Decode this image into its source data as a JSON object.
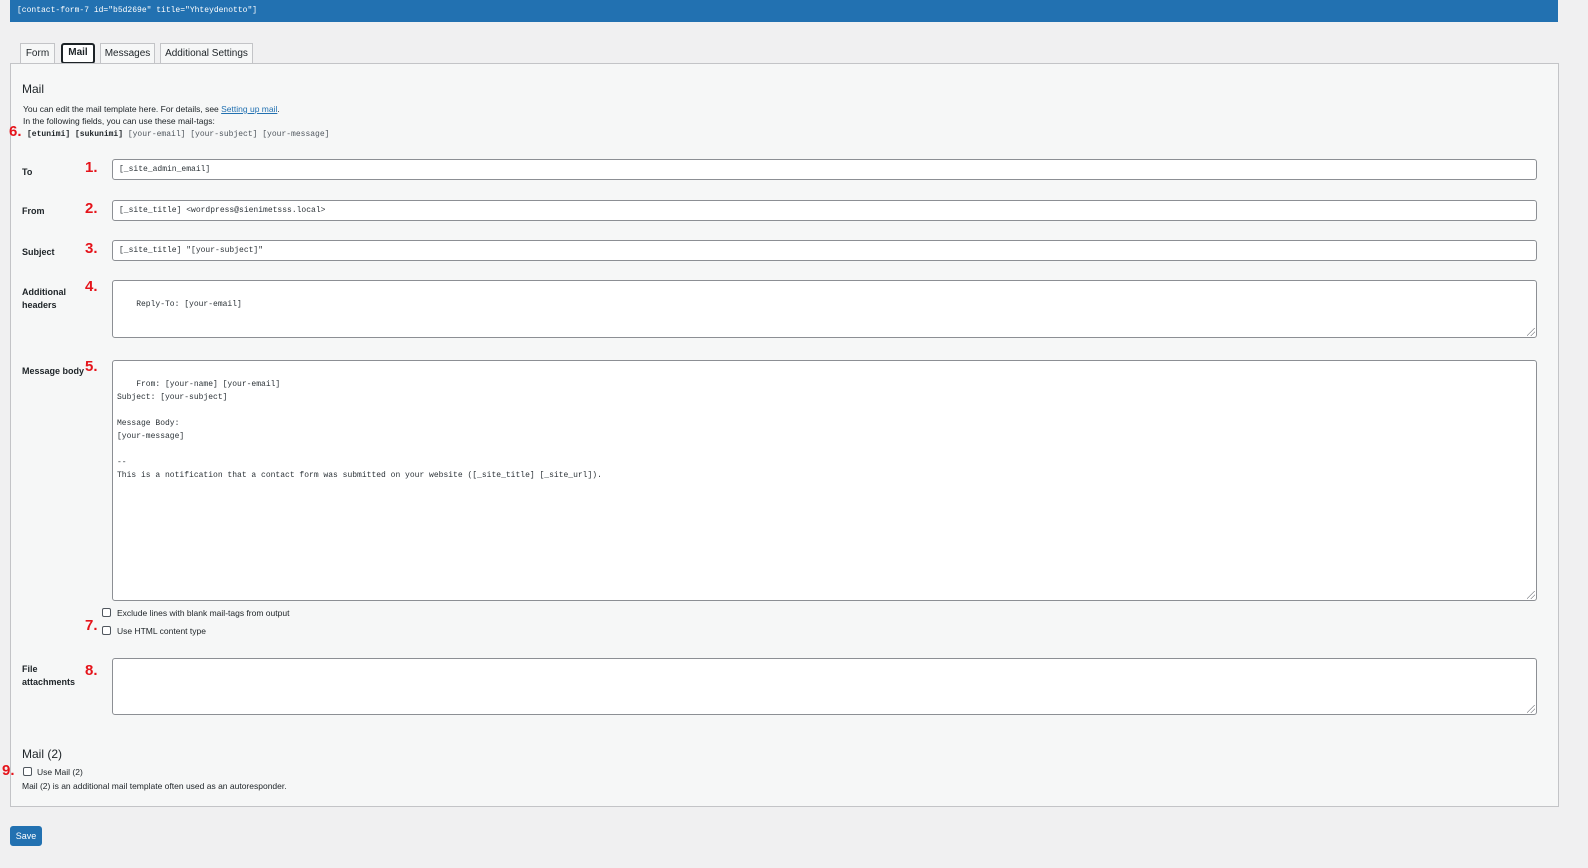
{
  "shortcode": "[contact-form-7 id=\"b5d269e\" title=\"Yhteydenotto\"]",
  "tabs": [
    {
      "label": "Form"
    },
    {
      "label": "Mail"
    },
    {
      "label": "Messages"
    },
    {
      "label": "Additional Settings"
    }
  ],
  "mail": {
    "title": "Mail",
    "intro_text": "You can edit the mail template here. For details, see ",
    "intro_link": "Setting up mail",
    "intro_end": ".",
    "tags_intro": "In the following fields, you can use these mail-tags:",
    "tags_bold": "[etunimi] [sukunimi]",
    "tags_rest": " [your-email] [your-subject] [your-message]",
    "to_label": "To",
    "to_value": "[_site_admin_email]",
    "from_label": "From",
    "from_value": "[_site_title] <wordpress@sienimetsss.local>",
    "subject_label": "Subject",
    "subject_value": "[_site_title] \"[your-subject]\"",
    "headers_label_1": "Additional",
    "headers_label_2": "headers",
    "headers_value": "Reply-To: [your-email]",
    "body_label": "Message body",
    "body_value": "From: [your-name] [your-email]\nSubject: [your-subject]\n\nMessage Body:\n[your-message]\n\n--\nThis is a notification that a contact form was submitted on your website ([_site_title] [_site_url]).",
    "exclude_blank_label": "Exclude lines with blank mail-tags from output",
    "html_type_label": "Use HTML content type",
    "attachments_label_1": "File",
    "attachments_label_2": "attachments",
    "attachments_value": ""
  },
  "mail2": {
    "title": "Mail (2)",
    "use_label": "Use Mail (2)",
    "description": "Mail (2) is an additional mail template often used as an autoresponder."
  },
  "markers": {
    "m1": "1.",
    "m2": "2.",
    "m3": "3.",
    "m4": "4.",
    "m5": "5.",
    "m6": "6.",
    "m7": "7.",
    "m8": "8.",
    "m9": "9."
  },
  "save_label": "Save"
}
